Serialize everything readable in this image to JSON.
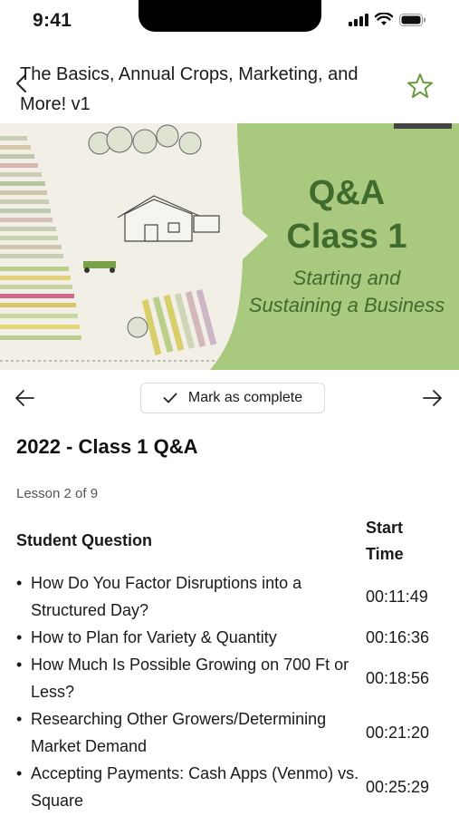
{
  "status_bar": {
    "time": "9:41"
  },
  "header": {
    "title": "The Basics, Annual Crops, Marketing, and More! v1"
  },
  "hero": {
    "title_line1": "Q&A",
    "title_line2": "Class 1",
    "subtitle_line1": "Starting and",
    "subtitle_line2": "Sustaining a Business",
    "colors": {
      "panel": "#a9c97e",
      "text": "#3f6b2e"
    }
  },
  "lesson_nav": {
    "complete_label": "Mark as complete"
  },
  "lesson": {
    "title": "2022 - Class 1 Q&A",
    "count": "Lesson 2 of 9"
  },
  "table": {
    "col_question": "Student Question",
    "col_time": "Start Time",
    "rows": [
      {
        "question": "How Do You Factor Disruptions into a Structured Day?",
        "time": "00:11:49"
      },
      {
        "question": "How to Plan for Variety & Quantity",
        "time": "00:16:36"
      },
      {
        "question": "How Much Is Possible Growing on 700 Ft or Less?",
        "time": "00:18:56"
      },
      {
        "question": "Researching Other Growers/Determining Market Demand",
        "time": "00:21:20"
      },
      {
        "question": "Accepting Payments: Cash Apps (Venmo) vs. Square",
        "time": "00:25:29"
      }
    ]
  }
}
